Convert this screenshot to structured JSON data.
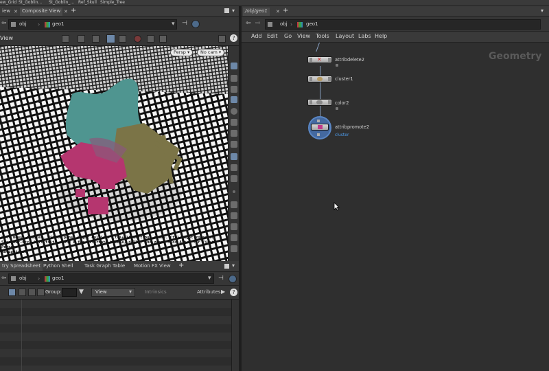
{
  "shelf_tabs": [
    "ew_Grid",
    "St_Goblin...",
    "St_Goblin_...",
    "Ref_Skull",
    "Simple_Tree"
  ],
  "left": {
    "top_tabs": [
      {
        "label": "iew",
        "active": false
      },
      {
        "label": "Composite View",
        "active": true
      }
    ],
    "path": {
      "root": "obj",
      "node": "geo1"
    },
    "viewport_label": "View",
    "camera_menus": {
      "perspective": "Persp ▾",
      "camera": "No cam ▾"
    },
    "viewport_info": [
      "Left mouse tumbles. Middle pans. Right dollies. Ctrl+Alt+Left box-zooms. Ctrl+Right zooms to",
      "Spacebar-Ctrl-Left tilts. Hold L for alternate tumble, dolly, and zoom.    M or Alt+M for First Person",
      "Navigation."
    ],
    "lower_tabs": [
      "try Spreadsheet",
      "Python Shell",
      "Task Graph Table",
      "Motion FX View"
    ],
    "lower_path": {
      "root": "obj",
      "node": "geo1"
    },
    "spreadsheet_toolbar": {
      "group_label": "Group:",
      "view_label": "View",
      "intrinsics_label": "Intrinsics",
      "attributes_label": "Attributes"
    }
  },
  "right": {
    "tabs": [
      {
        "label": "/obj/geo1",
        "active": true
      }
    ],
    "path": {
      "root": "obj",
      "node": "geo1"
    },
    "menus": [
      "Add",
      "Edit",
      "Go",
      "View",
      "Tools",
      "Layout",
      "Labs",
      "Help"
    ],
    "context_label": "Geometry",
    "nodes": [
      {
        "name": "attribdelete2",
        "sub": ""
      },
      {
        "name": "cluster1",
        "sub": ""
      },
      {
        "name": "color2",
        "sub": ""
      },
      {
        "name": "attribpromote2",
        "sub": "cluster"
      }
    ]
  },
  "colors": {
    "teal": "#4f9590",
    "olive": "#7b7447",
    "magenta": "#b5366f",
    "accent_blue": "#4d9ef0"
  }
}
